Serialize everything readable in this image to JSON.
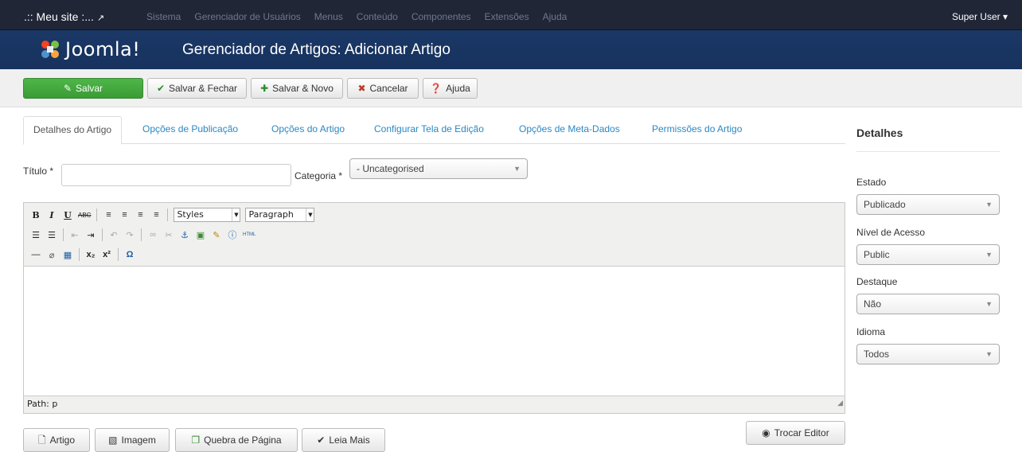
{
  "navbar": {
    "site": ".:: Meu site :...",
    "menu": [
      "Sistema",
      "Gerenciador de Usuários",
      "Menus",
      "Conteúdo",
      "Componentes",
      "Extensões",
      "Ajuda"
    ],
    "user": "Super User ▾"
  },
  "header": {
    "logo": "Joomla!",
    "title": "Gerenciador de Artigos: Adicionar Artigo"
  },
  "toolbar": {
    "save": "Salvar",
    "save_close": "Salvar & Fechar",
    "save_new": "Salvar & Novo",
    "cancel": "Cancelar",
    "help": "Ajuda"
  },
  "tabs": [
    "Detalhes do Artigo",
    "Opções de Publicação",
    "Opções do Artigo",
    "Configurar Tela de Edição",
    "Opções de Meta-Dados",
    "Permissões do Artigo"
  ],
  "form": {
    "title_label": "Título *",
    "title_value": "",
    "category_label": "Categoria *",
    "category_value": "- Uncategorised"
  },
  "editor": {
    "styles": "Styles",
    "format": "Paragraph",
    "path": "Path: p"
  },
  "buttons": {
    "article": "Artigo",
    "image": "Imagem",
    "pagebreak": "Quebra de Página",
    "readmore": "Leia Mais",
    "toggle": "Trocar Editor"
  },
  "sidebar": {
    "title": "Detalhes",
    "fields": [
      {
        "label": "Estado",
        "value": "Publicado"
      },
      {
        "label": "Nível de Acesso",
        "value": "Public"
      },
      {
        "label": "Destaque",
        "value": "Não"
      },
      {
        "label": "Idioma",
        "value": "Todos"
      }
    ]
  },
  "colors": {
    "navbar": "#202636",
    "header": "#1a3867",
    "save_button": "#46a546",
    "link": "#2a88c4"
  }
}
